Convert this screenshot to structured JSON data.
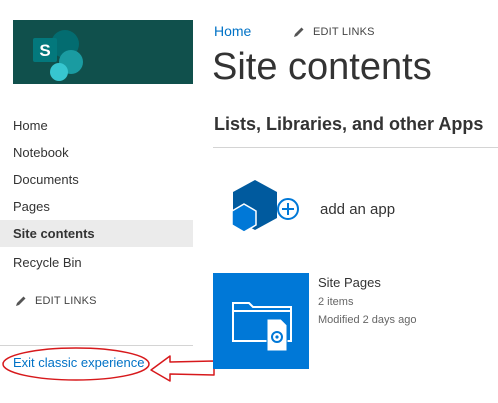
{
  "nav": {
    "items": [
      {
        "label": "Home"
      },
      {
        "label": "Notebook"
      },
      {
        "label": "Documents"
      },
      {
        "label": "Pages"
      },
      {
        "label": "Site contents"
      },
      {
        "label": "Recycle Bin"
      }
    ],
    "edit_links": "EDIT LINKS",
    "exit_classic": "Exit classic experience"
  },
  "header": {
    "breadcrumb_home": "Home",
    "edit_links": "EDIT LINKS",
    "title": "Site contents"
  },
  "main": {
    "section_heading": "Lists, Libraries, and other Apps",
    "add_app_label": "add an app",
    "apps": [
      {
        "name": "Site Pages",
        "items": "2 items",
        "modified": "Modified 2 days ago"
      }
    ]
  },
  "colors": {
    "logo_background": "#10504c",
    "link_blue": "#0072c6",
    "tile_blue": "#0078d7",
    "add_app_blue": "#005a9e",
    "annotation_red": "#d7191c"
  },
  "icons": {
    "logo": "sharepoint-logo",
    "edit": "pencil-icon",
    "add_app": "add-app-icon",
    "tile": "document-library-icon"
  }
}
